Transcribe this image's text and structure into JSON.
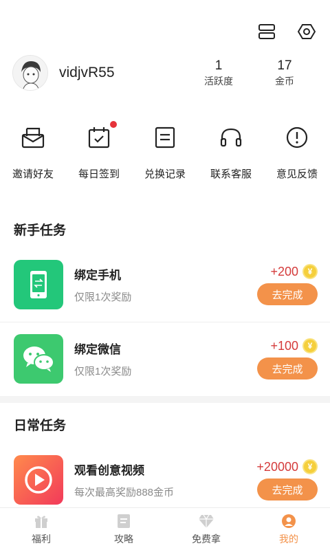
{
  "profile": {
    "username": "vidjvR55",
    "stats": [
      {
        "value": "1",
        "label": "活跃度"
      },
      {
        "value": "17",
        "label": "金币"
      }
    ]
  },
  "shortcuts": [
    {
      "label": "邀请好友",
      "icon": "envelope-icon"
    },
    {
      "label": "每日签到",
      "icon": "calendar-check-icon",
      "badge": true
    },
    {
      "label": "兑换记录",
      "icon": "list-icon"
    },
    {
      "label": "联系客服",
      "icon": "headset-icon"
    },
    {
      "label": "意见反馈",
      "icon": "alert-circle-icon"
    }
  ],
  "sections": {
    "newbie_title": "新手任务",
    "daily_title": "日常任务"
  },
  "tasks": [
    {
      "name": "绑定手机",
      "desc": "仅限1次奖励",
      "reward": "+200",
      "button": "去完成",
      "icon": "phone-icon",
      "color": "#23c77a"
    },
    {
      "name": "绑定微信",
      "desc": "仅限1次奖励",
      "reward": "+100",
      "button": "去完成",
      "icon": "wechat-icon",
      "color": "#3dc96f"
    },
    {
      "name": "观看创意视频",
      "desc": "每次最高奖励888金币",
      "reward": "+20000",
      "button": "去完成",
      "icon": "play-icon",
      "color": "#f54a4f"
    }
  ],
  "coin_glyph": "¥",
  "bottom_nav": [
    {
      "label": "福利",
      "icon": "gift-icon"
    },
    {
      "label": "攻略",
      "icon": "document-icon"
    },
    {
      "label": "免费拿",
      "icon": "diamond-icon"
    },
    {
      "label": "我的",
      "icon": "user-icon",
      "active": true
    }
  ],
  "colors": {
    "accent": "#f3924a",
    "reward_red": "#d43a3a",
    "badge_red": "#e6333a"
  }
}
